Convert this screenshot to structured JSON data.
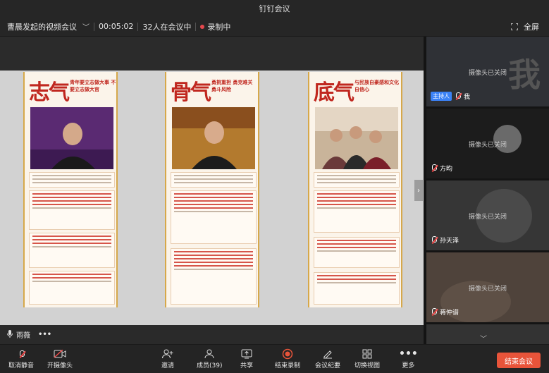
{
  "window": {
    "title": "钉钉会议"
  },
  "infobar": {
    "meeting_name": "曹晨发起的视频会议",
    "elapsed": "00:05:02",
    "participants_in_meeting": "32人在会议中",
    "recording": "录制中",
    "fullscreen_label": "全屏"
  },
  "slide": {
    "posters": [
      {
        "title": "志气",
        "subtitle": "青年要立志做大事 不要立志做大官"
      },
      {
        "title": "骨气",
        "subtitle": "勇挑重担 勇克难关 勇斗风险"
      },
      {
        "title": "底气",
        "subtitle": "与民族自豪感和文化自信心"
      }
    ]
  },
  "speaker": {
    "name": "雨薇"
  },
  "gallery": {
    "tiles": [
      {
        "status": "摄像头已关闭",
        "name": "我",
        "badge": "主持人",
        "watermark": "我"
      },
      {
        "status": "摄像头已关闭",
        "name": "方昀"
      },
      {
        "status": "摄像头已关闭",
        "name": "孙天泽"
      },
      {
        "status": "摄像头已关闭",
        "name": "蒋仲谱"
      }
    ]
  },
  "toolbar": {
    "mute": "取消静音",
    "camera": "开摄像头",
    "invite": "邀请",
    "members": "成员(39)",
    "share": "共享",
    "end_record": "结束录制",
    "minutes": "会议纪要",
    "switch_view": "切换视图",
    "more": "更多",
    "end_meeting": "结束会议"
  },
  "colors": {
    "accent_red": "#e8543a",
    "host_badge": "#3b82f6",
    "poster_red": "#c0271f"
  }
}
